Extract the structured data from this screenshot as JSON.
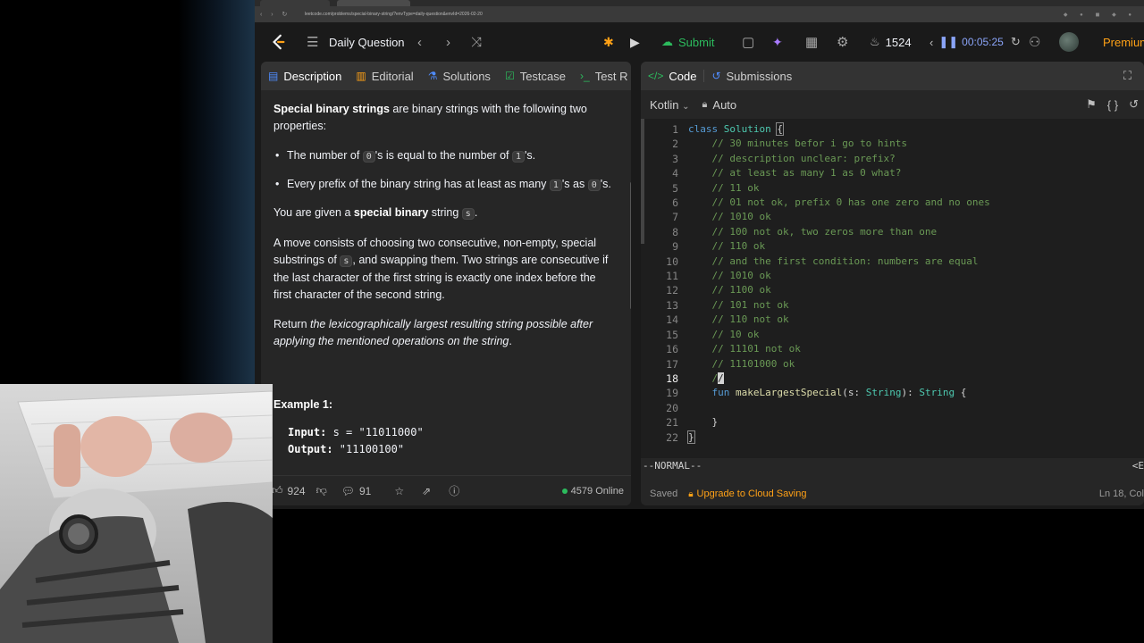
{
  "browser": {
    "url": "leetcode.com/problems/special-binary-string/?envType=daily-question&envId=2026-02-20",
    "tab_colors": [
      "#c23b3b",
      "#4a4a4a"
    ]
  },
  "nav": {
    "title": "Daily Question",
    "submit_label": "Submit",
    "streak_count": "1524",
    "timer": "00:05:25",
    "premium_label": "Premium"
  },
  "left_tabs": [
    {
      "label": "Description",
      "icon": "description-icon"
    },
    {
      "label": "Editorial",
      "icon": "editorial-icon"
    },
    {
      "label": "Solutions",
      "icon": "solutions-icon"
    },
    {
      "label": "Testcase",
      "icon": "testcase-icon"
    },
    {
      "label": "Test R",
      "icon": "test-result-icon"
    }
  ],
  "description": {
    "p1_bold": "Special binary strings",
    "p1_rest": " are binary strings with the following two properties:",
    "b1_a": "The number of ",
    "b1_c1": "0",
    "b1_b": "'s is equal to the number of ",
    "b1_c2": "1",
    "b1_c": "'s.",
    "b2_a": "Every prefix of the binary string has at least as many ",
    "b2_c1": "1",
    "b2_b": "'s as ",
    "b2_c2": "0",
    "b2_c": "'s.",
    "p2_a": "You are given a ",
    "p2_bold": "special binary",
    "p2_b": " string ",
    "p2_code": "s",
    "p2_c": ".",
    "p3_a": "A move consists of choosing two consecutive, non-empty, special substrings of ",
    "p3_code": "s",
    "p3_b": ", and swapping them. Two strings are consecutive if the last character of the first string is exactly one index before the first character of the second string.",
    "p4_a": "Return ",
    "p4_i": "the lexicographically largest resulting string possible after applying the mentioned operations on the string",
    "p4_b": ".",
    "example_title": "Example 1:",
    "input_label": "Input:",
    "input_value": " s = \"11011000\"",
    "output_label": "Output:",
    "output_value": " \"11100100\""
  },
  "left_footer": {
    "likes": "924",
    "comments": "91",
    "online": "4579 Online"
  },
  "right_tabs": [
    {
      "label": "Code",
      "icon": "code-icon"
    },
    {
      "label": "Submissions",
      "icon": "submissions-icon"
    }
  ],
  "editor": {
    "language": "Kotlin",
    "mode": "Auto",
    "line_numbers": [
      "1",
      "2",
      "3",
      "4",
      "5",
      "6",
      "7",
      "8",
      "9",
      "10",
      "11",
      "12",
      "13",
      "14",
      "15",
      "16",
      "17",
      "18",
      "19",
      "20",
      "21",
      "22"
    ],
    "current_line": "18",
    "status": "--NORMAL--",
    "status_right": "<E",
    "saved": "Saved",
    "upgrade": "Upgrade to Cloud Saving",
    "position": "Ln 18, Col"
  },
  "code": {
    "l1_kw": "class",
    "l1_cls": "Solution",
    "l1_b": "{",
    "comments": [
      "// 30 minutes befor i go to hints",
      "// description unclear: prefix?",
      "// at least as many 1 as 0 what?",
      "// 11 ok",
      "// 01 not ok, prefix 0 has one zero and no ones",
      "// 1010 ok",
      "// 100 not ok, two zeros more than one",
      "// 110 ok",
      "// and the first condition: numbers are equal",
      "// 1010 ok",
      "// 1100 ok",
      "// 101 not ok",
      "// 110 not ok",
      "// 10 ok",
      "// 11101 not ok",
      "// 11101000 ok"
    ],
    "l18": "/",
    "l18_cursor": "/",
    "l19_kw": "fun",
    "l19_fn": "makeLargestSpecial",
    "l19_a": "(s: ",
    "l19_t1": "String",
    "l19_b": "): ",
    "l19_t2": "String",
    "l19_c": " {",
    "l21": "}",
    "l22": "}"
  }
}
